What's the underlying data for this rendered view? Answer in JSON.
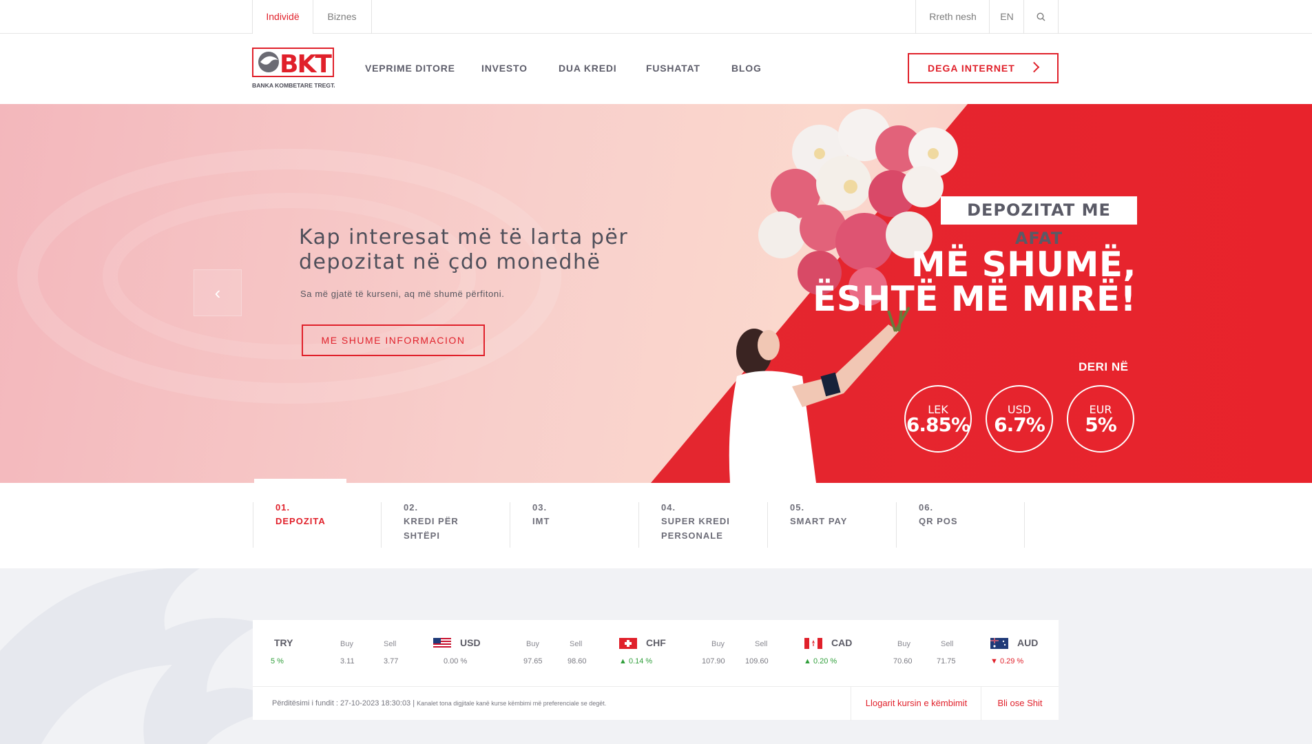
{
  "top_bar": {
    "tabs": [
      {
        "label": "Individë",
        "active": true
      },
      {
        "label": "Biznes",
        "active": false
      }
    ],
    "links": {
      "about": "Rreth nesh",
      "language": "EN"
    },
    "icons": {
      "search": "search-icon"
    }
  },
  "header": {
    "logo": {
      "mark": "BKT",
      "tagline": "BANKA KOMBETARE TREGTARE"
    },
    "nav": [
      "VEPRIME DITORE",
      "INVESTO",
      "DUA KREDI",
      "FUSHATAT",
      "BLOG"
    ],
    "cta_label": "DEGA INTERNET"
  },
  "hero": {
    "title": "Kap interesat më të larta për depozitat në çdo monedhë",
    "subtitle": "Sa më gjatë të kurseni, aq më shumë përfitoni.",
    "cta_label": "ME SHUME INFORMACION",
    "prev_icon": "‹",
    "promo": {
      "tag": "DEPOZITAT ME AFAT",
      "headline_line1": "MË SHUMË,",
      "headline_line2": "ËSHTË MË MIRË!",
      "deri": "DERI NË",
      "rates": [
        {
          "currency": "LEK",
          "value": "6.85%"
        },
        {
          "currency": "USD",
          "value": "6.7%"
        },
        {
          "currency": "EUR",
          "value": "5%"
        }
      ]
    },
    "colors": {
      "accent": "#e0202a",
      "pink": "#f8cfcb"
    }
  },
  "slides": [
    {
      "num": "01.",
      "label": "DEPOZITA",
      "active": true
    },
    {
      "num": "02.",
      "label": "KREDI PËR SHTËPI",
      "active": false
    },
    {
      "num": "03.",
      "label": "IMT",
      "active": false
    },
    {
      "num": "04.",
      "label": "SUPER KREDI PERSONALE",
      "active": false
    },
    {
      "num": "05.",
      "label": "SMART PAY",
      "active": false
    },
    {
      "num": "06.",
      "label": "QR POS",
      "active": false
    }
  ],
  "rates": {
    "buy_label": "Buy",
    "sell_label": "Sell",
    "items": [
      {
        "code": "TRY",
        "flag": "none",
        "change": "5 %",
        "direction": "up",
        "buy": "3.11",
        "sell": "3.77"
      },
      {
        "code": "USD",
        "flag": "us-flag-icon",
        "change": "0.00 %",
        "direction": "flat",
        "buy": "97.65",
        "sell": "98.60"
      },
      {
        "code": "CHF",
        "flag": "ch-flag-icon",
        "change": "0.14 %",
        "direction": "up",
        "buy": "107.90",
        "sell": "109.60"
      },
      {
        "code": "CAD",
        "flag": "ca-flag-icon",
        "change": "0.20 %",
        "direction": "up",
        "buy": "70.60",
        "sell": "71.75"
      },
      {
        "code": "AUD",
        "flag": "au-flag-icon",
        "change": "0.29 %",
        "direction": "down"
      }
    ],
    "footer": {
      "updated": "Përditësimi i fundit : 27-10-2023 18:30:03 |",
      "note": "Kanalet tona digjitale kanë kurse këmbimi më preferenciale se degët.",
      "calc_link": "Llogarit kursin e këmbimit",
      "buy_sell_link": "Bli ose Shit"
    }
  }
}
